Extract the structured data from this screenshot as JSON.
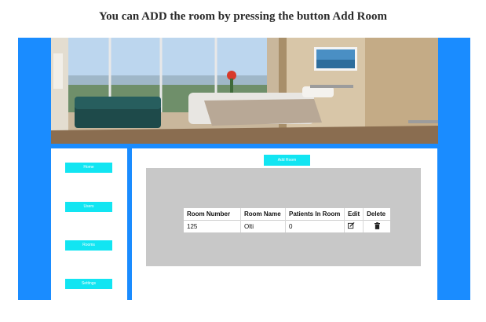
{
  "caption": "You can ADD the room by pressing the button Add Room",
  "sidebar": {
    "items": [
      {
        "label": "Home"
      },
      {
        "label": "Users"
      },
      {
        "label": "Rooms"
      },
      {
        "label": "Settings"
      }
    ]
  },
  "toolbar": {
    "add_room_label": "Add Room"
  },
  "table": {
    "headers": [
      "Room Number",
      "Room Name",
      "Patients In Room",
      "Edit",
      "Delete"
    ],
    "rows": [
      {
        "room_number": "125",
        "room_name": "Olti",
        "patients": "0",
        "edit_icon": "edit-icon",
        "delete_icon": "trash-icon"
      }
    ]
  },
  "colors": {
    "frame": "#1a8cff",
    "accent": "#12e5f2",
    "panel": "#c8c8c8"
  }
}
